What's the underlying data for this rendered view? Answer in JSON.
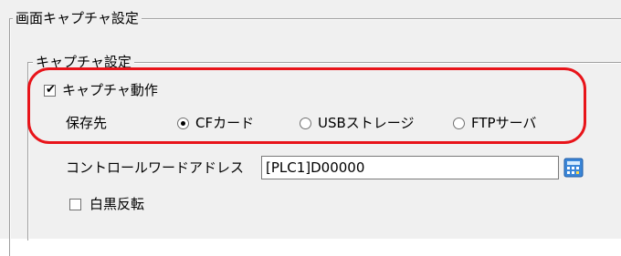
{
  "screen_capture": {
    "group_title": "画面キャプチャ設定",
    "capture_group": {
      "title": "キャプチャ設定",
      "capture_action_label": "キャプチャ動作",
      "capture_action_checked": true,
      "destination_label": "保存先",
      "destinations": [
        {
          "label": "CFカード",
          "selected": true
        },
        {
          "label": "USBストレージ",
          "selected": false
        },
        {
          "label": "FTPサーバ",
          "selected": false
        }
      ],
      "control_word_label": "コントロールワードアドレス",
      "control_word_value": "[PLC1]D00000",
      "invert_label": "白黒反転",
      "invert_checked": false
    }
  },
  "colors": {
    "highlight": "#e8141a",
    "panel_background": "#f0f0f0"
  },
  "icons": {
    "address_picker": "keypad-icon"
  }
}
